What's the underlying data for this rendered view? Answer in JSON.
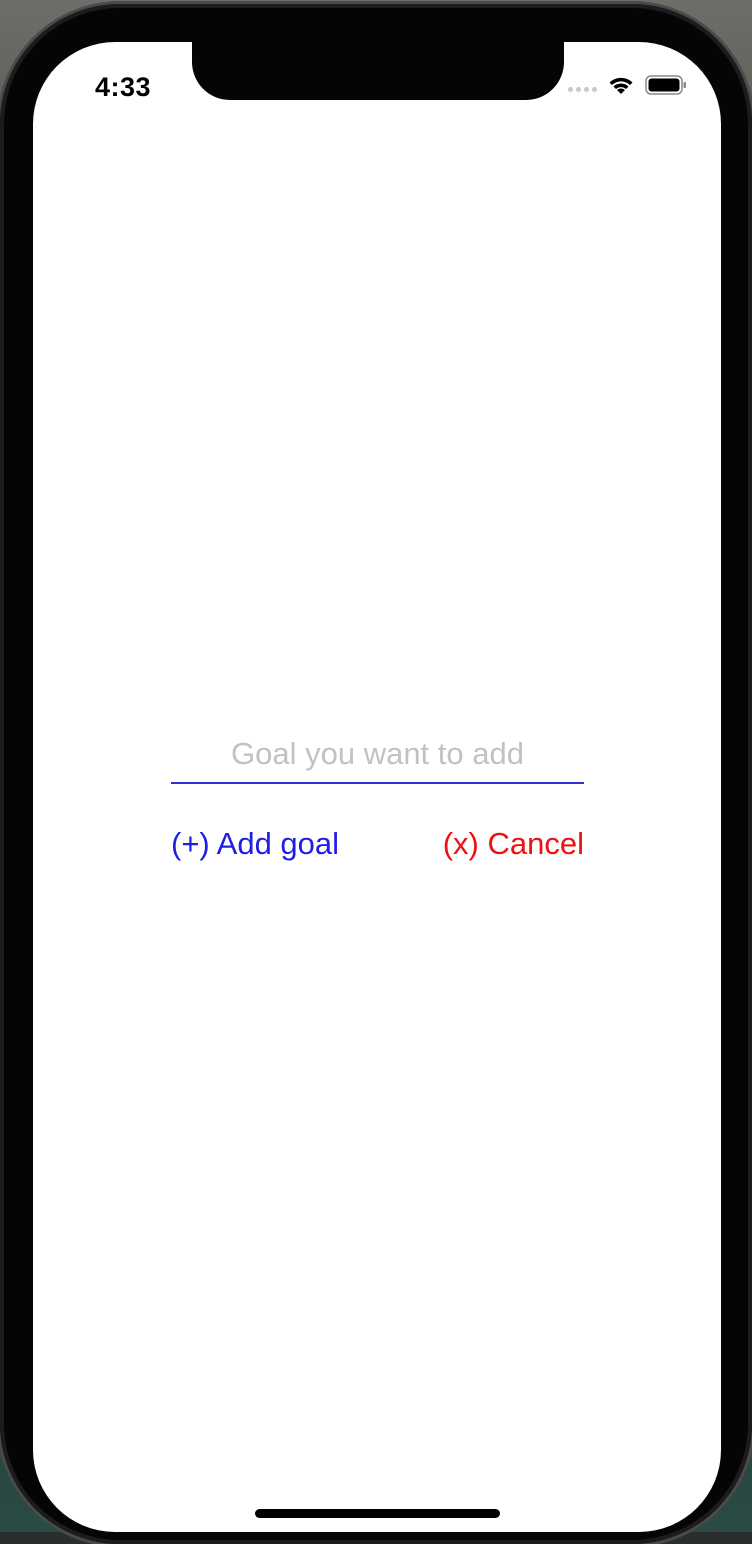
{
  "status_bar": {
    "time": "4:33",
    "icons": [
      "signal-dots-icon",
      "wifi-icon",
      "battery-icon"
    ]
  },
  "goal_input": {
    "value": "",
    "placeholder": "Goal you want to add"
  },
  "buttons": {
    "add_label": "(+) Add goal",
    "cancel_label": "(x) Cancel"
  },
  "colors": {
    "accent_blue": "#1e1ee6",
    "cancel_red": "#ee1111",
    "input_underline": "#2f2fd8",
    "placeholder_gray": "#c2c2c2"
  }
}
